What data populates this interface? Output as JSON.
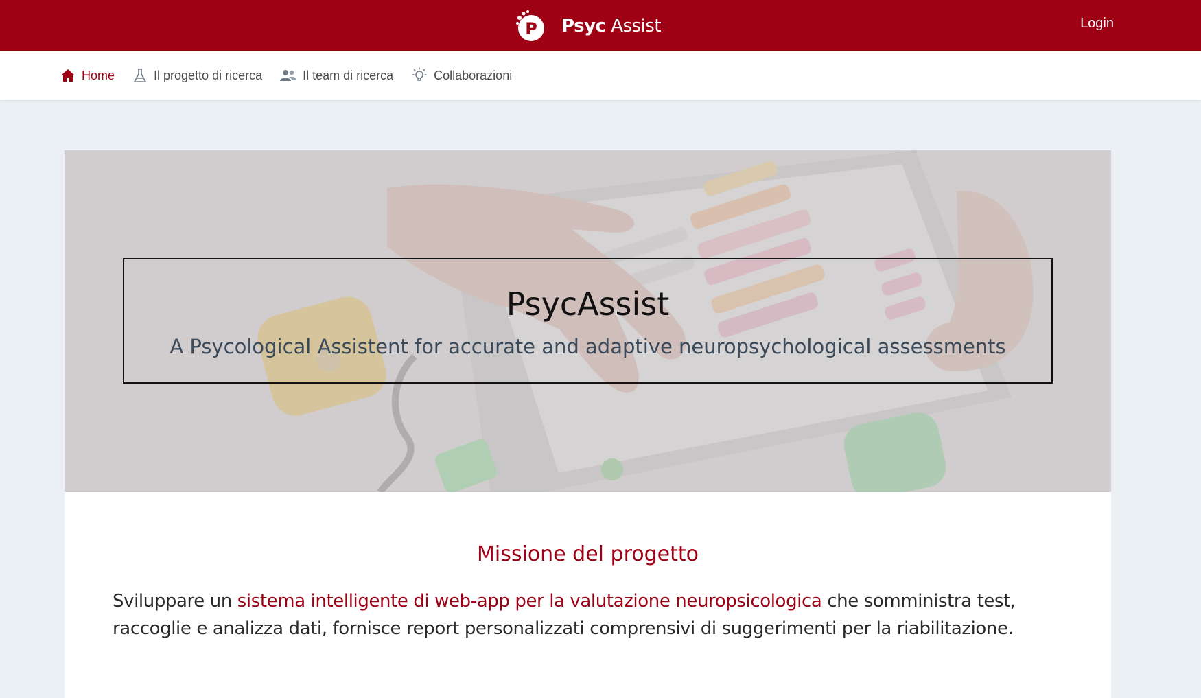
{
  "header": {
    "brand_part1": "Psyc",
    "brand_part2": "Assist",
    "logo_letter": "P",
    "login_label": "Login"
  },
  "nav": {
    "items": [
      {
        "label": "Home",
        "icon": "home-icon",
        "active": true
      },
      {
        "label": "Il progetto di ricerca",
        "icon": "flask-icon",
        "active": false
      },
      {
        "label": "Il team di ricerca",
        "icon": "people-icon",
        "active": false
      },
      {
        "label": "Collaborazioni",
        "icon": "lightbulb-icon",
        "active": false
      }
    ]
  },
  "hero": {
    "title": "PsycAssist",
    "subtitle": "A Psycological Assistent for accurate and adaptive neuropsychological assessments"
  },
  "mission": {
    "title": "Missione del progetto",
    "text_before": "Sviluppare un ",
    "text_highlight": "sistema intelligente di web-app per la valutazione neuropsicologica",
    "text_after": " che somministra test, raccoglie e analizza dati, fornisce report personalizzati comprensivi di suggerimenti per la riabilitazione."
  },
  "colors": {
    "brand": "#9e0014",
    "background": "#eaf0f3",
    "text": "#2a2a2a"
  }
}
